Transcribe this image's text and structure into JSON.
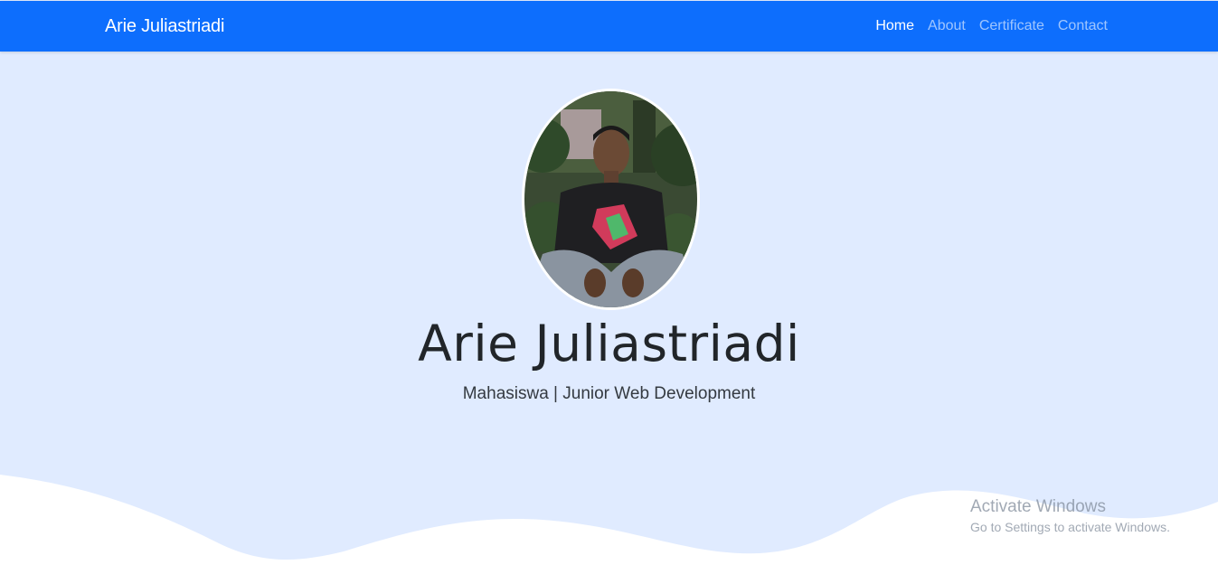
{
  "navbar": {
    "brand": "Arie Juliastriadi",
    "links": [
      {
        "label": "Home",
        "active": true
      },
      {
        "label": "About",
        "active": false
      },
      {
        "label": "Certificate",
        "active": false
      },
      {
        "label": "Contact",
        "active": false
      }
    ]
  },
  "hero": {
    "name": "Arie Juliastriadi",
    "subtitle": "Mahasiswa | Junior Web Development",
    "avatar_icon": "profile-photo"
  },
  "watermark": {
    "title": "Activate Windows",
    "subtitle": "Go to Settings to activate Windows."
  },
  "colors": {
    "navbar": "#0d6efd",
    "hero_bg": "#e0ebff",
    "wave": "#ffffff"
  }
}
